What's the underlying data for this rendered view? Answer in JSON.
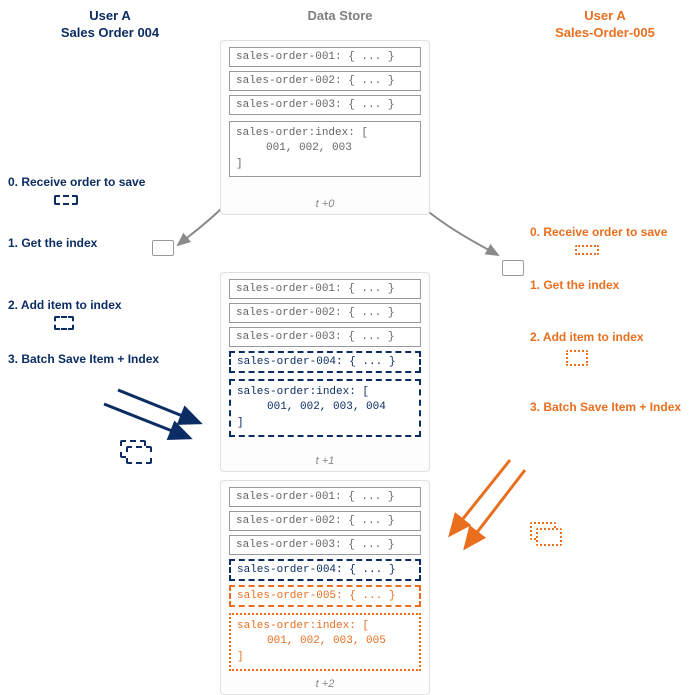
{
  "columns": {
    "left": {
      "user": "User A",
      "order": "Sales Order 004"
    },
    "center": {
      "title": "Data Store"
    },
    "right": {
      "user": "User A",
      "order": "Sales-Order-005"
    }
  },
  "steps": {
    "left": {
      "s0": "0. Receive order to save",
      "s1": "1. Get the index",
      "s2": "2. Add item to index",
      "s3": "3. Batch Save Item + Index"
    },
    "right": {
      "s0": "0. Receive order to save",
      "s1": "1. Get the index",
      "s2": "2. Add item to index",
      "s3": "3. Batch Save Item + Index"
    }
  },
  "stores": {
    "t0": {
      "rows": [
        "sales-order-001: { ... }",
        "sales-order-002: { ... }",
        "sales-order-003: { ... }"
      ],
      "index_head": "sales-order:index: [",
      "index_body": "001, 002, 003",
      "index_tail": "]",
      "tstamp": "t +0"
    },
    "t1": {
      "rows": [
        "sales-order-001: { ... }",
        "sales-order-002: { ... }",
        "sales-order-003: { ... }",
        "sales-order-004: { ... }"
      ],
      "index_head": "sales-order:index: [",
      "index_body": "001, 002, 003, 004",
      "index_tail": "]",
      "tstamp": "t +1"
    },
    "t2": {
      "rows": [
        "sales-order-001: { ... }",
        "sales-order-002: { ... }",
        "sales-order-003: { ... }",
        "sales-order-004: { ... }",
        "sales-order-005: { ... }"
      ],
      "index_head": "sales-order:index: [",
      "index_body": "001, 002, 003, 005",
      "index_tail": "]",
      "tstamp": "t +2"
    }
  },
  "colors": {
    "blue": "#0c2d63",
    "orange": "#e96f1f",
    "gray": "#808080"
  }
}
